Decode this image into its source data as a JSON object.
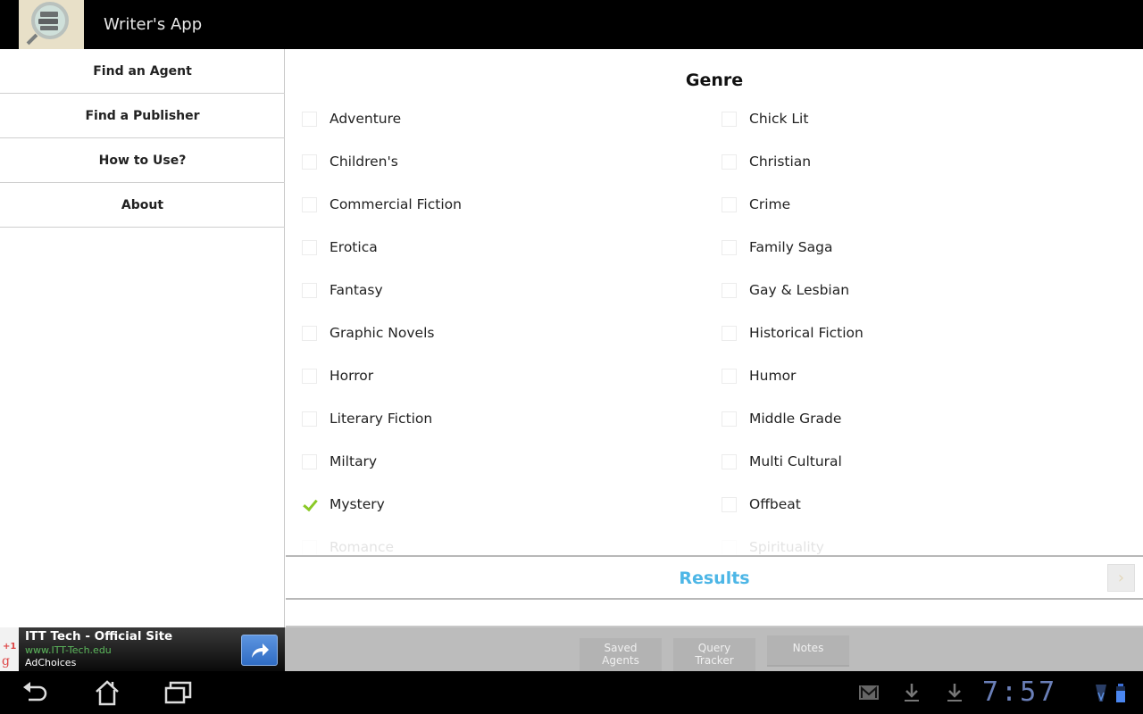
{
  "app": {
    "title": "Writer's App",
    "icon": "books-magnifier-icon"
  },
  "sidebar": {
    "items": [
      {
        "label": "Find an Agent"
      },
      {
        "label": "Find a Publisher"
      },
      {
        "label": "How to Use?"
      },
      {
        "label": "About"
      }
    ]
  },
  "main": {
    "section_title": "Genre",
    "genres_left": [
      {
        "label": "Adventure",
        "checked": false
      },
      {
        "label": "Children's",
        "checked": false
      },
      {
        "label": "Commercial Fiction",
        "checked": false
      },
      {
        "label": "Erotica",
        "checked": false
      },
      {
        "label": "Fantasy",
        "checked": false
      },
      {
        "label": " Graphic Novels",
        "checked": false
      },
      {
        "label": " Horror",
        "checked": false
      },
      {
        "label": "Literary Fiction",
        "checked": false
      },
      {
        "label": "Miltary",
        "checked": false
      },
      {
        "label": "Mystery",
        "checked": true
      },
      {
        "label": "Romance",
        "checked": false
      }
    ],
    "genres_right": [
      {
        "label": "Chick Lit",
        "checked": false
      },
      {
        "label": "Christian",
        "checked": false
      },
      {
        "label": "Crime",
        "checked": false
      },
      {
        "label": "Family Saga",
        "checked": false
      },
      {
        "label": "Gay & Lesbian",
        "checked": false
      },
      {
        "label": "Historical Fiction",
        "checked": false
      },
      {
        "label": "Humor",
        "checked": false
      },
      {
        "label": "Middle Grade",
        "checked": false
      },
      {
        "label": "Multi Cultural",
        "checked": false
      },
      {
        "label": "Offbeat",
        "checked": false
      },
      {
        "label": "Spirituality",
        "checked": false
      }
    ],
    "results_label": "Results",
    "results_next_icon": "chevron-right-icon",
    "accent_color": "#4db6e6",
    "check_color": "#8ac926"
  },
  "ad": {
    "title": "ITT Tech - Official Site",
    "url": "www.ITT-Tech.edu",
    "choices": "AdChoices",
    "plus_one": "+1",
    "g": "g"
  },
  "bottom_tabs": [
    {
      "label_line1": "Saved",
      "label_line2": "Agents"
    },
    {
      "label_line1": "Query",
      "label_line2": "Tracker"
    },
    {
      "label": "Notes"
    }
  ],
  "system_bar": {
    "clock": "7:57",
    "icons": [
      "back-icon",
      "home-icon",
      "recent-apps-icon",
      "gmail-icon",
      "download-icon",
      "download-icon",
      "wifi-icon",
      "battery-icon"
    ]
  }
}
